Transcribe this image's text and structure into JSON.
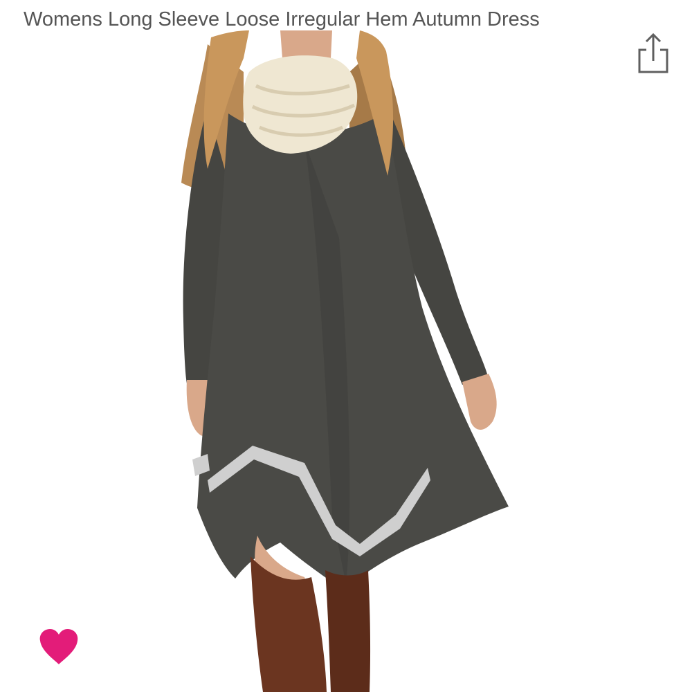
{
  "product": {
    "title": "Womens Long Sleeve Loose Irregular Hem Autumn Dress",
    "image_alt": "Womens Long Sleeve Loose Irregular Hem Autumn Dress"
  },
  "icons": {
    "share": "share-icon",
    "wishlist": "heart-icon"
  },
  "colors": {
    "title_text": "#555555",
    "share_icon": "#5f5f5f",
    "heart": "#e31c79",
    "dress": "#4a4a46",
    "trim": "#cfcfcf",
    "hair": "#b98a55",
    "scarf": "#efe7d2",
    "boots": "#6b3520",
    "skin": "#d9a88a"
  }
}
